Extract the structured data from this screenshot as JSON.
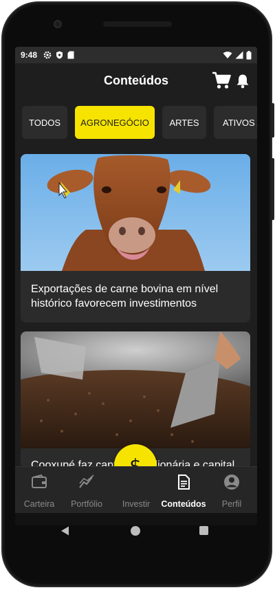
{
  "status_bar": {
    "time": "9:48",
    "left_icons": [
      "gear-icon",
      "shield-icon",
      "sd-card-icon"
    ],
    "right_icons": [
      "wifi-icon",
      "signal-icon",
      "battery-icon"
    ]
  },
  "header": {
    "title": "Conteúdos",
    "icons": [
      "cart-icon",
      "bell-icon"
    ]
  },
  "tabs": [
    {
      "label": "TODOS",
      "active": false
    },
    {
      "label": "AGRONEGÓCIO",
      "active": true
    },
    {
      "label": "ARTES",
      "active": false
    },
    {
      "label": "ATIVOS A",
      "active": false
    }
  ],
  "cards": [
    {
      "title": "Exportações de carne bovina em nível histórico favorecem investimentos",
      "image": "cow-photo"
    },
    {
      "title": "Cooxupé faz captação milionária e capital",
      "image": "coffee-roaster-photo"
    }
  ],
  "fab": {
    "symbol": "$",
    "icon": "dollar-icon"
  },
  "bottom_nav": [
    {
      "label": "Carteira",
      "icon": "wallet-icon",
      "active": false
    },
    {
      "label": "Portfólio",
      "icon": "chart-line-icon",
      "active": false
    },
    {
      "label": "Investir",
      "icon": "",
      "active": false
    },
    {
      "label": "Conteúdos",
      "icon": "document-icon",
      "active": true
    },
    {
      "label": "Perfil",
      "icon": "user-icon",
      "active": false
    }
  ],
  "colors": {
    "accent": "#f6e400",
    "background": "#1e1e1e",
    "tab_inactive": "#2c2c2c",
    "nav_inactive_text": "#8a8a8a"
  }
}
